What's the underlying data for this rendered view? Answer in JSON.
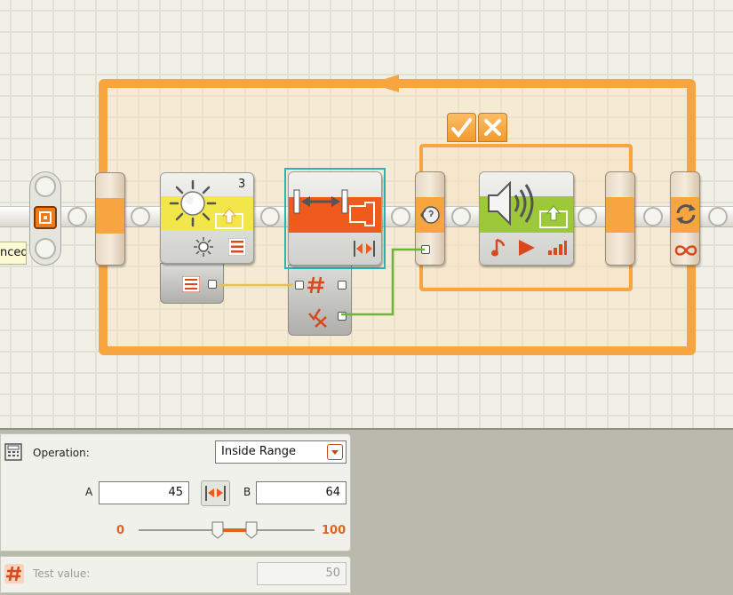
{
  "canvas": {
    "sensor_block": {
      "port_number": "3",
      "icon": "light-sensor-icon"
    },
    "range_block": {
      "icon": "range-icon"
    },
    "switch_block": {
      "true_tab_icon": "check-icon",
      "false_tab_icon": "cross-icon"
    },
    "sound_block": {
      "icon": "speaker-icon"
    },
    "loop_block": {
      "icon": "loop-arrows-icon",
      "mode_icon": "infinity-icon"
    },
    "side_label": "nced",
    "colors": {
      "loop_orange": "#f7a541",
      "sensor_yellow": "#f2e64a",
      "range_orange": "#f05a1d",
      "sound_green": "#9cc83a",
      "wire_yellow": "#e5c34a",
      "wire_green": "#6bb33a",
      "selection_teal": "#2bb5b0"
    }
  },
  "config": {
    "operation_label": "Operation:",
    "operation_value": "Inside Range",
    "a_label": "A",
    "a_value": "45",
    "b_label": "B",
    "b_value": "64",
    "slider_min": "0",
    "slider_max": "100",
    "slider_range_values": [
      45,
      64
    ],
    "slider_scale": [
      0,
      100
    ],
    "test_label": "Test value:",
    "test_value": "50"
  }
}
